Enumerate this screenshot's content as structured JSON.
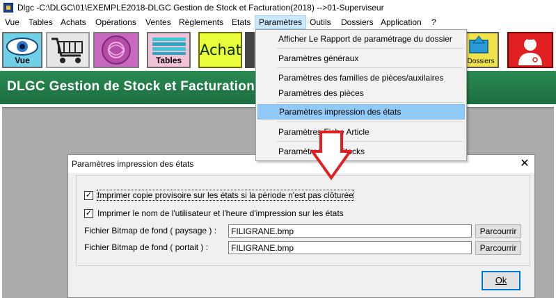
{
  "window": {
    "title": "Dlgc -C:\\DLGC\\01\\EXEMPLE2018-DLGC Gestion de Stock et Facturation(2018) -->01-Superviseur"
  },
  "menubar": {
    "items": [
      "Vue",
      "Tables",
      "Achats",
      "Opérations",
      "Ventes",
      "Règlements",
      "Etats",
      "Paramètres",
      "Outils",
      "Dossiers",
      "Application",
      "?"
    ]
  },
  "toolbar": {
    "vue_label": "Vue",
    "tables_label": "Tables",
    "achats_label": "Achats",
    "dossiers_label": "Dossiers"
  },
  "banner": {
    "text": "DLGC Gestion de Stock et Facturation"
  },
  "dropdown": {
    "items": [
      "Afficher Le Rapport de paramétrage du dossier",
      "Paramètres généraux",
      "Paramètres des familles de pièces/auxilaires",
      "Paramètres des pièces",
      "Paramètres impression des états",
      "Paramètres Fiche Article",
      "Paramètres des Stocks"
    ]
  },
  "dialog": {
    "title": "Paramètres impression des états",
    "close_glyph": "✕",
    "option1_label": "Imprimer copie provisoire sur les états si la période n'est pas clôturée",
    "option1_checked": true,
    "option2_label": "Imprimer le nom de l'utilisateur et l'heure d'impression sur les états",
    "option2_checked": true,
    "landscape_label": "Fichier Bitmap de fond ( paysage ) :",
    "landscape_value": "FILIGRANE.bmp",
    "portrait_label": "Fichier Bitmap de fond ( portait ) :",
    "portrait_value": "FILIGRANE.bmp",
    "browse_label": "Parcourrir",
    "ok_label": "Ok"
  },
  "colors": {
    "banner": "#1f7444",
    "menu_highlight": "#91c9f7",
    "arrow": "#e02020",
    "workspace": "#ababab"
  },
  "icons": [
    "eye-icon",
    "shopping-cart-icon",
    "pink-emblem-icon",
    "tables-icon",
    "achats-icon",
    "folder-up-icon",
    "doctor-icon"
  ]
}
